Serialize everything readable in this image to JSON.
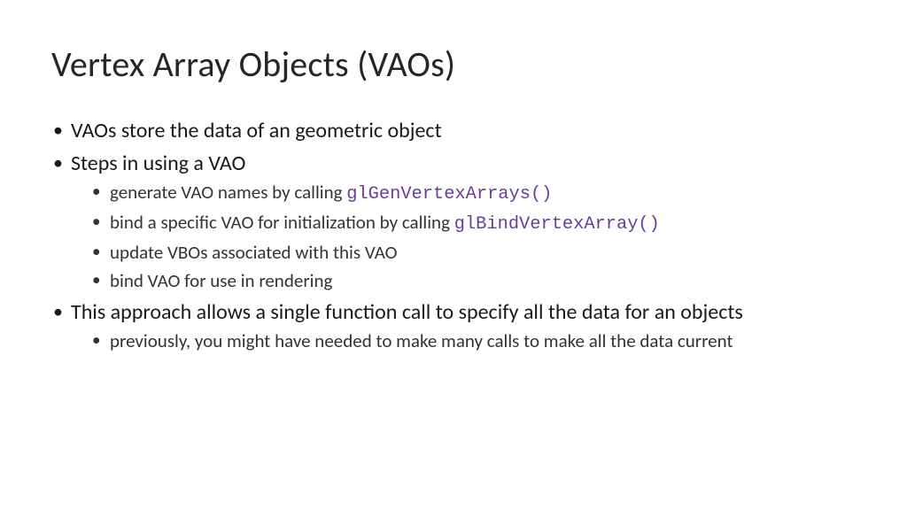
{
  "title": "Vertex Array Objects (VAOs)",
  "bullets": [
    {
      "text": "VAOs store the data of an geometric object",
      "children": []
    },
    {
      "text": "Steps in using a VAO",
      "children": [
        {
          "pre": "generate VAO names by calling ",
          "code": "glGenVertexArrays()"
        },
        {
          "pre": "bind a specific VAO for initialization by calling ",
          "code": "glBindVertexArray()"
        },
        {
          "pre": "update VBOs associated with this VAO",
          "code": ""
        },
        {
          "pre": "bind VAO for use in rendering",
          "code": ""
        }
      ]
    },
    {
      "text": "This approach allows a single function call to specify all the data for an objects",
      "children": [
        {
          "pre": "previously, you might have needed to make many calls to make all the data current",
          "code": ""
        }
      ]
    }
  ]
}
